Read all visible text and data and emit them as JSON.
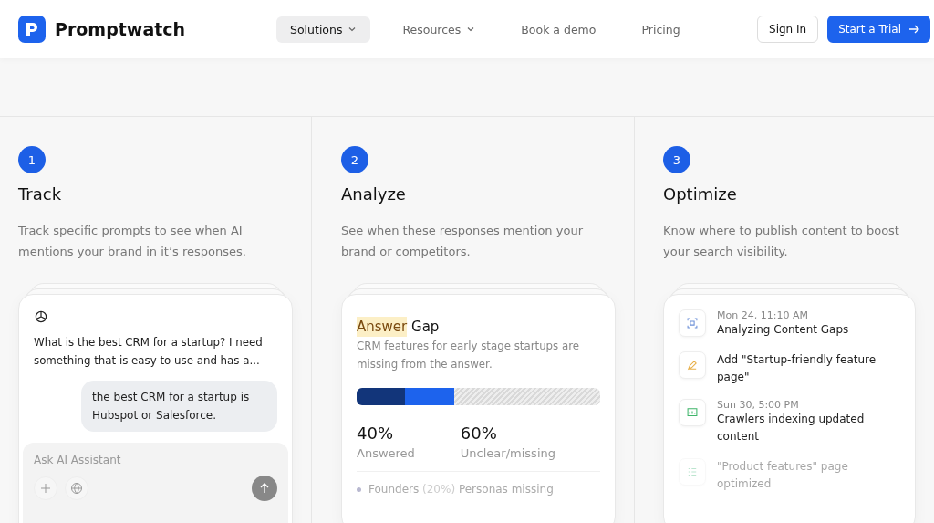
{
  "header": {
    "brand": "Promptwatch",
    "nav": [
      {
        "label": "Solutions",
        "dropdown": true,
        "selected": true
      },
      {
        "label": "Resources",
        "dropdown": true,
        "selected": false
      },
      {
        "label": "Book a demo",
        "dropdown": false,
        "selected": false
      },
      {
        "label": "Pricing",
        "dropdown": false,
        "selected": false
      }
    ],
    "sign_in": "Sign In",
    "cta": "Start a Trial"
  },
  "steps": [
    {
      "number": "1",
      "title": "Track",
      "description": "Track specific prompts to see when AI mentions your brand in it’s responses.",
      "card": {
        "kind": "chat",
        "question": "What is the best CRM for a startup? I need something that is easy to use and has a...",
        "answer": "the best CRM for a startup is Hubspot or Salesforce.",
        "input_placeholder": "Ask AI Assistant"
      }
    },
    {
      "number": "2",
      "title": "Analyze",
      "description": "See when these responses mention your brand or competitors.",
      "card": {
        "kind": "gap",
        "highlight": "Answer",
        "title": "Gap",
        "text": "CRM features for early stage startups are missing from the answer.",
        "segments": [
          {
            "level": 0.2,
            "color": "#12357a"
          },
          {
            "level": 0.2,
            "color": "#1d63ed"
          }
        ],
        "stats": [
          {
            "value": "40%",
            "label": "Answered"
          },
          {
            "value": "60%",
            "label": "Unclear/missing"
          }
        ],
        "persona": {
          "name": "Founders",
          "share": "(20%)",
          "text": "Personas missing"
        }
      }
    },
    {
      "number": "3",
      "title": "Optimize",
      "description": "Know where to publish content to boost your search visibility.",
      "card": {
        "kind": "timeline",
        "items": [
          {
            "kind": "scan",
            "time": "Mon 24, 11:10 AM",
            "text": "Analyzing Content Gaps",
            "faded": false
          },
          {
            "kind": "edit",
            "text": "Add \"Startup-friendly feature page\"",
            "faded": false
          },
          {
            "kind": "screen",
            "time": "Sun 30, 5:00 PM",
            "text": "Crawlers indexing updated content",
            "faded": false
          },
          {
            "kind": "list",
            "text": "\"Product features\" page optimized",
            "faded": true
          }
        ]
      }
    }
  ]
}
